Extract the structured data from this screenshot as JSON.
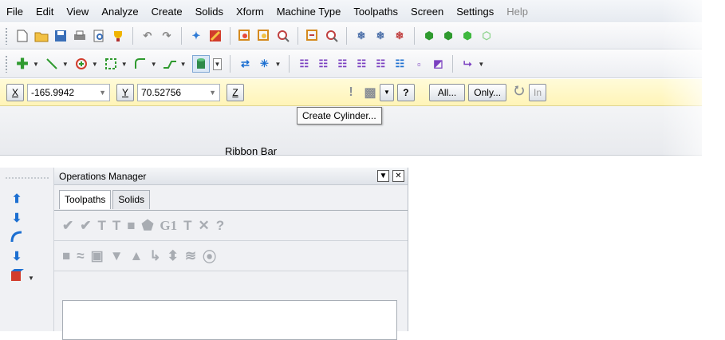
{
  "menu": [
    "File",
    "Edit",
    "View",
    "Analyze",
    "Create",
    "Solids",
    "Xform",
    "Machine Type",
    "Toolpaths",
    "Screen",
    "Settings",
    "Help"
  ],
  "coord": {
    "x_label": "X",
    "x_value": "-165.9942",
    "y_label": "Y",
    "y_value": "70.52756",
    "z_label": "Z",
    "all_label": "All...",
    "only_label": "Only...",
    "trailing_label": "In"
  },
  "tooltip": "Create Cylinder...",
  "ribbon_label": "Ribbon Bar",
  "ops": {
    "title": "Operations Manager",
    "tab_toolpaths": "Toolpaths",
    "tab_solids": "Solids",
    "g1_label": "G1"
  },
  "colors": {
    "accent_green": "#2f9a2f",
    "accent_blue": "#1c6fd1",
    "accent_red": "#d23c2c",
    "coordbar_bg": "#fff4b8"
  }
}
